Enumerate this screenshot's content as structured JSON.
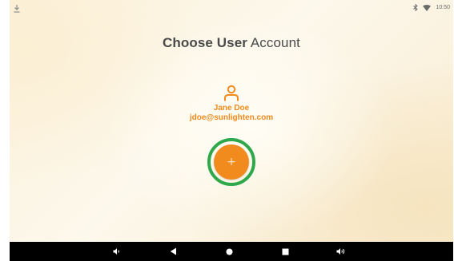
{
  "status_bar": {
    "time": "10:50",
    "icons": [
      "download-icon",
      "bluetooth-icon",
      "wifi-icon"
    ]
  },
  "page": {
    "title_bold": "Choose User",
    "title_rest": " Account"
  },
  "account": {
    "icon": "user-icon",
    "name": "Jane Doe",
    "email": "jdoe@sunlighten.com"
  },
  "add_button": {
    "icon": "plus-icon",
    "glyph": "+"
  },
  "nav_bar": {
    "buttons": [
      "volume-down-icon",
      "back-icon",
      "home-icon",
      "recents-icon",
      "volume-up-icon"
    ]
  },
  "colors": {
    "accent": "#f28b1e",
    "highlight_ring": "#2ea84a",
    "title": "#4a4a4a"
  }
}
